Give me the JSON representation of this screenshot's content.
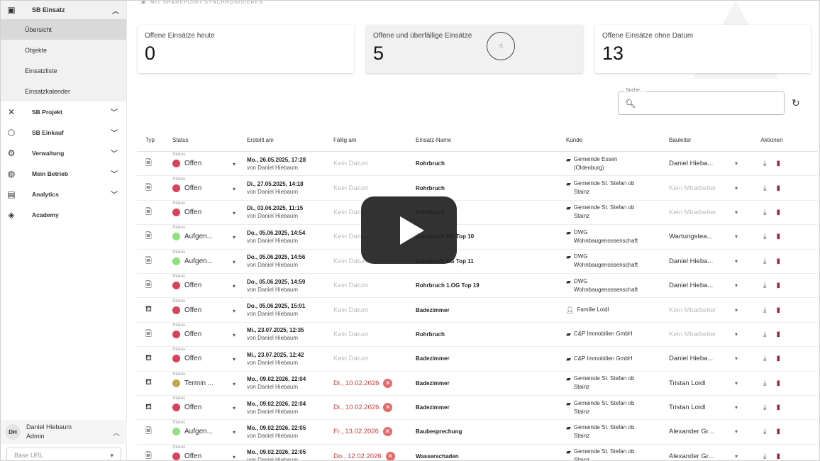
{
  "sidebar": {
    "group": {
      "label": "SB Einsatz",
      "items": [
        "Übersicht",
        "Objekte",
        "Einsatzliste",
        "Einsatzkalender"
      ]
    },
    "items": [
      {
        "label": "SB Projekt",
        "icon": "tools-icon"
      },
      {
        "label": "SB Einkauf",
        "icon": "cube-icon"
      },
      {
        "label": "Verwaltung",
        "icon": "gear-icon"
      },
      {
        "label": "Mein Betrieb",
        "icon": "globe-icon"
      },
      {
        "label": "Analytics",
        "icon": "chart-icon"
      },
      {
        "label": "Academy",
        "icon": "graduation-icon"
      }
    ],
    "user": {
      "initials": "DH",
      "name": "Daniel Hiebaum",
      "role": "Admin"
    },
    "base_url": "Base URL"
  },
  "main": {
    "sync_label": "MIT SHAREPOINT SYNCHRONISIEREN",
    "cards": [
      {
        "label": "Offene Einsätze heute",
        "value": "0"
      },
      {
        "label": "Offene und überfällige Einsätze",
        "value": "5"
      },
      {
        "label": "Offene Einsätze ohne Datum",
        "value": "13"
      }
    ],
    "search_label": "Suche...",
    "columns": [
      "Typ",
      "Status",
      "Erstellt am",
      "Fällig am",
      "Einsatz-Name",
      "Kunde",
      "Bauleiter",
      "Aktionen"
    ],
    "status_caption": "Status",
    "colors": {
      "offen": "#d9435a",
      "aufgenommen": "#8fe27b",
      "termin": "#c8a64a",
      "overdue": "#d03b3b"
    },
    "rows": [
      {
        "typ": "document-icon",
        "status": "Offen",
        "status_color": "#d9435a",
        "created": "Mo., 26.05.2025, 17:28",
        "by": "von Daniel Hiebaum",
        "due": "Kein Datum",
        "due_type": "none",
        "name": "Rohrbruch",
        "kunde_icon": "building-icon",
        "kunde": [
          "Gemeinde Essen",
          "(Oldenburg)"
        ],
        "bauleiter": "Daniel Hieba...",
        "bau_none": false
      },
      {
        "typ": "document-icon",
        "status": "Offen",
        "status_color": "#d9435a",
        "created": "Di., 27.05.2025, 14:18",
        "by": "von Daniel Hiebaum",
        "due": "Kein Datum",
        "due_type": "none",
        "name": "Rohrbruch",
        "kunde_icon": "building-icon",
        "kunde": [
          "Gemeinde St. Stefan ob",
          "Stainz"
        ],
        "bauleiter": "Kein Mitarbeiter",
        "bau_none": true
      },
      {
        "typ": "document-icon",
        "status": "Offen",
        "status_color": "#d9435a",
        "created": "Di., 03.06.2025, 11:15",
        "by": "von Daniel Hiebaum",
        "due": "Kein Datum",
        "due_type": "none",
        "name": "Rohrbruch",
        "kunde_icon": "building-icon",
        "kunde": [
          "Gemeinde St. Stefan ob",
          "Stainz"
        ],
        "bauleiter": "Kein Mitarbeiter",
        "bau_none": true
      },
      {
        "typ": "document-icon",
        "status": "Aufgen...",
        "status_color": "#8fe27b",
        "created": "Do., 05.06.2025, 14:54",
        "by": "von Daniel Hiebaum",
        "due": "Kein Datum",
        "due_type": "none",
        "name": "Rohrbruch EG Top 10",
        "kunde_icon": "building-icon",
        "kunde": [
          "DWG",
          "Wohnbaugenossenschaft"
        ],
        "bauleiter": "Wartungstea...",
        "bau_none": false
      },
      {
        "typ": "document-icon",
        "status": "Aufgen...",
        "status_color": "#8fe27b",
        "created": "Do., 05.06.2025, 14:56",
        "by": "von Daniel Hiebaum",
        "due": "Kein Datum",
        "due_type": "none",
        "name": "Rohrbruch EG Top 11",
        "kunde_icon": "building-icon",
        "kunde": [
          "DWG",
          "Wohnbaugenossenschaft"
        ],
        "bauleiter": "Daniel Hieba...",
        "bau_none": false
      },
      {
        "typ": "document-icon",
        "status": "Offen",
        "status_color": "#d9435a",
        "created": "Do., 05.06.2025, 14:59",
        "by": "von Daniel Hiebaum",
        "due": "Kein Datum",
        "due_type": "none",
        "name": "Rohrbruch 1.OG Top 19",
        "kunde_icon": "building-icon",
        "kunde": [
          "DWG",
          "Wohnbaugenossenschaft"
        ],
        "bauleiter": "Daniel Hieba...",
        "bau_none": false
      },
      {
        "typ": "bath-icon",
        "status": "Offen",
        "status_color": "#d9435a",
        "created": "Do., 05.06.2025, 15:01",
        "by": "von Daniel Hiebaum",
        "due": "Kein Datum",
        "due_type": "none",
        "name": "Badezimmer",
        "kunde_icon": "person-icon",
        "kunde": [
          "Familie Loidl",
          ""
        ],
        "bauleiter": "Kein Mitarbeiter",
        "bau_none": true
      },
      {
        "typ": "document-icon",
        "status": "Offen",
        "status_color": "#d9435a",
        "created": "Mi., 23.07.2025, 12:35",
        "by": "von Daniel Hiebaum",
        "due": "Kein Datum",
        "due_type": "none",
        "name": "Rohrbruch",
        "kunde_icon": "building-icon",
        "kunde": [
          "C&P Immobilien GmbH",
          ""
        ],
        "bauleiter": "Kein Mitarbeiter",
        "bau_none": true
      },
      {
        "typ": "bath-icon",
        "status": "Offen",
        "status_color": "#d9435a",
        "created": "Mi., 23.07.2025, 12:42",
        "by": "von Daniel Hiebaum",
        "due": "Kein Datum",
        "due_type": "none",
        "name": "Badezimmer",
        "kunde_icon": "building-icon",
        "kunde": [
          "C&P Immobilien GmbH",
          ""
        ],
        "bauleiter": "Daniel Hieba...",
        "bau_none": false
      },
      {
        "typ": "bath-icon",
        "status": "Termin ...",
        "status_color": "#c8a64a",
        "created": "Mo., 09.02.2026, 22:04",
        "by": "von Daniel Hiebaum",
        "due": "Di., 10.02.2026",
        "due_type": "over",
        "name": "Badezimmer",
        "kunde_icon": "building-icon",
        "kunde": [
          "Gemeinde St. Stefan ob",
          "Stainz"
        ],
        "bauleiter": "Tristan Loidl",
        "bau_none": false
      },
      {
        "typ": "bath-icon",
        "status": "Offen",
        "status_color": "#d9435a",
        "created": "Mo., 09.02.2026, 22:04",
        "by": "von Daniel Hiebaum",
        "due": "Di., 10.02.2026",
        "due_type": "over",
        "name": "Badezimmer",
        "kunde_icon": "building-icon",
        "kunde": [
          "Gemeinde St. Stefan ob",
          "Stainz"
        ],
        "bauleiter": "Tristan Loidl",
        "bau_none": false
      },
      {
        "typ": "document-icon",
        "status": "Aufgen...",
        "status_color": "#8fe27b",
        "created": "Mo., 09.02.2026, 22:05",
        "by": "von Daniel Hiebaum",
        "due": "Fr., 13.02.2026",
        "due_type": "over",
        "name": "Baubesprechung",
        "kunde_icon": "building-icon",
        "kunde": [
          "Gemeinde St. Stefan ob",
          "Stainz"
        ],
        "bauleiter": "Alexander Gr...",
        "bau_none": false
      },
      {
        "typ": "document-icon",
        "status": "Offen",
        "status_color": "#d9435a",
        "created": "Mo., 09.02.2026, 22:05",
        "by": "von Daniel Hiebaum",
        "due": "Do., 12.02.2026",
        "due_type": "over",
        "name": "Wasserschaden",
        "kunde_icon": "building-icon",
        "kunde": [
          "Gemeinde St. Stefan ob",
          "Stainz"
        ],
        "bauleiter": "Alexander Gr...",
        "bau_none": false
      }
    ]
  }
}
